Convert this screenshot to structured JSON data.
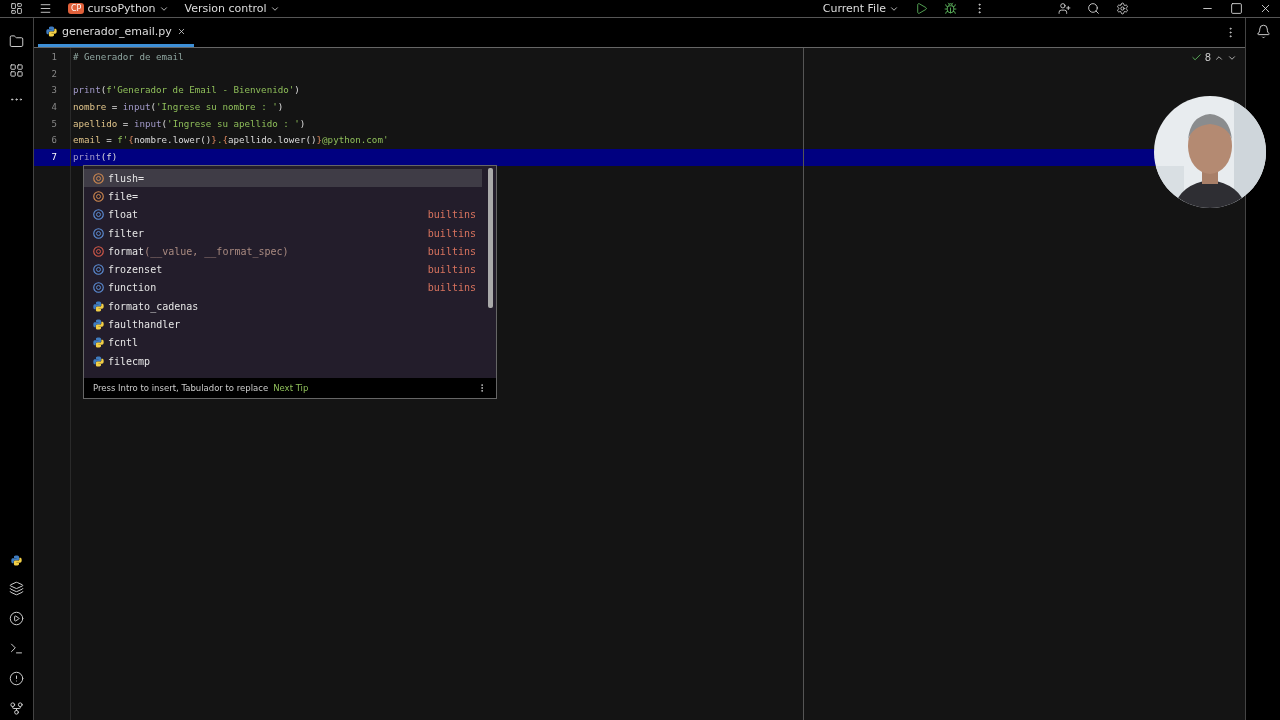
{
  "title_bar": {
    "project_badge": "CP",
    "project": "cursoPython",
    "vcs": "Version control",
    "run_config": "Current File"
  },
  "tabs": [
    {
      "label": "generador_email.py",
      "selected": true
    }
  ],
  "inspections": {
    "count": "8"
  },
  "code_lines": [
    {
      "number": "1",
      "selected": false,
      "tokens": [
        {
          "kind": "comment",
          "text": "# Generador de email"
        }
      ]
    },
    {
      "number": "2",
      "selected": false
    },
    {
      "number": "3",
      "selected": false,
      "tokens": [
        {
          "kind": "call",
          "text": "print"
        },
        {
          "kind": "plain",
          "text": "("
        },
        {
          "kind": "string",
          "text": "f'Generador de Email - Bienvenido'"
        },
        {
          "kind": "plain",
          "text": ")"
        }
      ]
    },
    {
      "number": "4",
      "selected": false,
      "tokens": [
        {
          "kind": "variable",
          "text": "nombre"
        },
        {
          "kind": "plain",
          "text": " = "
        },
        {
          "kind": "call",
          "text": "input"
        },
        {
          "kind": "plain",
          "text": "("
        },
        {
          "kind": "string",
          "text": "'Ingrese su nombre : '"
        },
        {
          "kind": "plain",
          "text": ")"
        }
      ]
    },
    {
      "number": "5",
      "selected": false,
      "tokens": [
        {
          "kind": "variable",
          "text": "apellido"
        },
        {
          "kind": "plain",
          "text": " = "
        },
        {
          "kind": "call",
          "text": "input"
        },
        {
          "kind": "plain",
          "text": "("
        },
        {
          "kind": "string",
          "text": "'Ingrese su apellido : '"
        },
        {
          "kind": "plain",
          "text": ")"
        }
      ]
    },
    {
      "number": "6",
      "selected": false,
      "tokens": [
        {
          "kind": "variable",
          "text": "email"
        },
        {
          "kind": "plain",
          "text": " = "
        },
        {
          "kind": "string",
          "text": "f'"
        },
        {
          "kind": "brace",
          "text": "{"
        },
        {
          "kind": "plain",
          "text": "nombre.lower()"
        },
        {
          "kind": "brace",
          "text": "}"
        },
        {
          "kind": "string",
          "text": "."
        },
        {
          "kind": "brace",
          "text": "{"
        },
        {
          "kind": "plain",
          "text": "apellido.lower()"
        },
        {
          "kind": "brace",
          "text": "}"
        },
        {
          "kind": "string",
          "text": "@python.com'"
        }
      ]
    },
    {
      "number": "7",
      "selected": true,
      "tokens": [
        {
          "kind": "call",
          "text": "print"
        },
        {
          "kind": "plain",
          "text": "(f)"
        }
      ]
    }
  ],
  "completion": {
    "items": [
      {
        "kind": "parameter",
        "label": "flush=",
        "selected": true
      },
      {
        "kind": "parameter",
        "label": "file=",
        "selected": false
      },
      {
        "kind": "class",
        "label": "float",
        "source": "builtins",
        "selected": false
      },
      {
        "kind": "class",
        "label": "filter",
        "source": "builtins",
        "selected": false
      },
      {
        "kind": "function",
        "label": "format",
        "signature": "(__value, __format_spec)",
        "source": "builtins",
        "selected": false
      },
      {
        "kind": "class",
        "label": "frozenset",
        "source": "builtins",
        "selected": false
      },
      {
        "kind": "class",
        "label": "function",
        "source": "builtins",
        "selected": false
      },
      {
        "kind": "module",
        "label": "formato_cadenas",
        "selected": false
      },
      {
        "kind": "module",
        "label": "faulthandler",
        "selected": false
      },
      {
        "kind": "module",
        "label": "fcntl",
        "selected": false
      },
      {
        "kind": "module",
        "label": "filecmp",
        "selected": false
      }
    ],
    "hint": "Press Intro to insert, Tabulador to replace",
    "next_tip": "Next Tip"
  }
}
